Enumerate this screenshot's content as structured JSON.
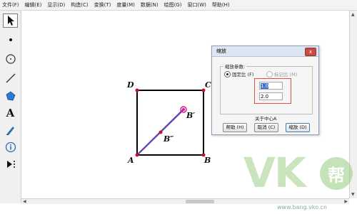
{
  "menubar": {
    "items": [
      "文件(F)",
      "编辑(E)",
      "显示(D)",
      "构造(C)",
      "变换(T)",
      "度量(M)",
      "数据(N)",
      "绘图(G)",
      "窗口(W)",
      "帮助(H)"
    ]
  },
  "toolbar": {
    "tools": [
      "arrow-select-tool",
      "point-tool",
      "compass-tool",
      "line-tool",
      "polygon-tool",
      "text-tool",
      "marker-tool",
      "info-tool",
      "custom-tool"
    ],
    "text_tool_glyph": "A"
  },
  "canvas": {
    "labels": {
      "D": "D",
      "C": "C",
      "A": "A",
      "B": "B",
      "B_prime": "B′",
      "B_double_prime": "B″"
    },
    "colors": {
      "square": "#000000",
      "segment": "#7a2a8a",
      "point": "#c8102e",
      "dilated_point": "#d81b8a"
    }
  },
  "dialog": {
    "title": "缩放",
    "close": "x",
    "group_label": "缩放参数:",
    "radio_fixed": "固定比 (F)",
    "radio_marked": "标记比 (M)",
    "field1_value": "1.0",
    "field2_value": "2.0",
    "center_label": "关于中心A",
    "buttons": {
      "help": "帮助 (H)",
      "cancel": "取消 (C)",
      "ok": "缩放 (D)"
    }
  },
  "watermark": {
    "logo_text": "VK",
    "logo_char": "帮",
    "url": "www.bang.vko.cn"
  }
}
